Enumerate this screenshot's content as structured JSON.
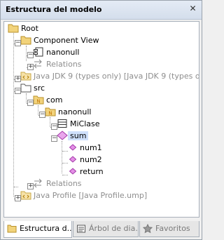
{
  "panel": {
    "title": "Estructura del modelo",
    "close_glyph": "✕"
  },
  "tree": [
    {
      "label": "Root",
      "icon": "root-folder-icon"
    },
    {
      "label": "Component View",
      "icon": "folder-icon"
    },
    {
      "label": "nanonull",
      "icon": "component-icon"
    },
    {
      "label": "Relations",
      "icon": "relations-icon"
    },
    {
      "label": "Java JDK 9 (types only) [Java JDK 9 (types only)]",
      "icon": "library-icon"
    },
    {
      "label": "src",
      "icon": "package-icon"
    },
    {
      "label": "com",
      "icon": "namespace-icon"
    },
    {
      "label": "nanonull",
      "icon": "namespace-icon"
    },
    {
      "label": "MiClase",
      "icon": "class-icon"
    },
    {
      "label": "sum",
      "icon": "operation-icon",
      "selected": true
    },
    {
      "label": "num1",
      "icon": "parameter-icon"
    },
    {
      "label": "num2",
      "icon": "parameter-icon"
    },
    {
      "label": "return",
      "icon": "parameter-icon"
    },
    {
      "label": "Relations",
      "icon": "relations-icon"
    },
    {
      "label": "Java Profile [Java Profile.ump]",
      "icon": "profile-icon"
    }
  ],
  "tabs": [
    {
      "label": "Estructura d...",
      "icon": "model-structure-icon",
      "active": true
    },
    {
      "label": "Árbol de dia...",
      "icon": "diagram-tree-icon",
      "active": false
    },
    {
      "label": "Favoritos",
      "icon": "favorites-icon",
      "active": false
    }
  ],
  "colors": {
    "folder": "#f2d37b",
    "class": "#333333",
    "operation": "#c04cc6",
    "parameter": "#d780d9",
    "namespace": "#e9a200"
  }
}
